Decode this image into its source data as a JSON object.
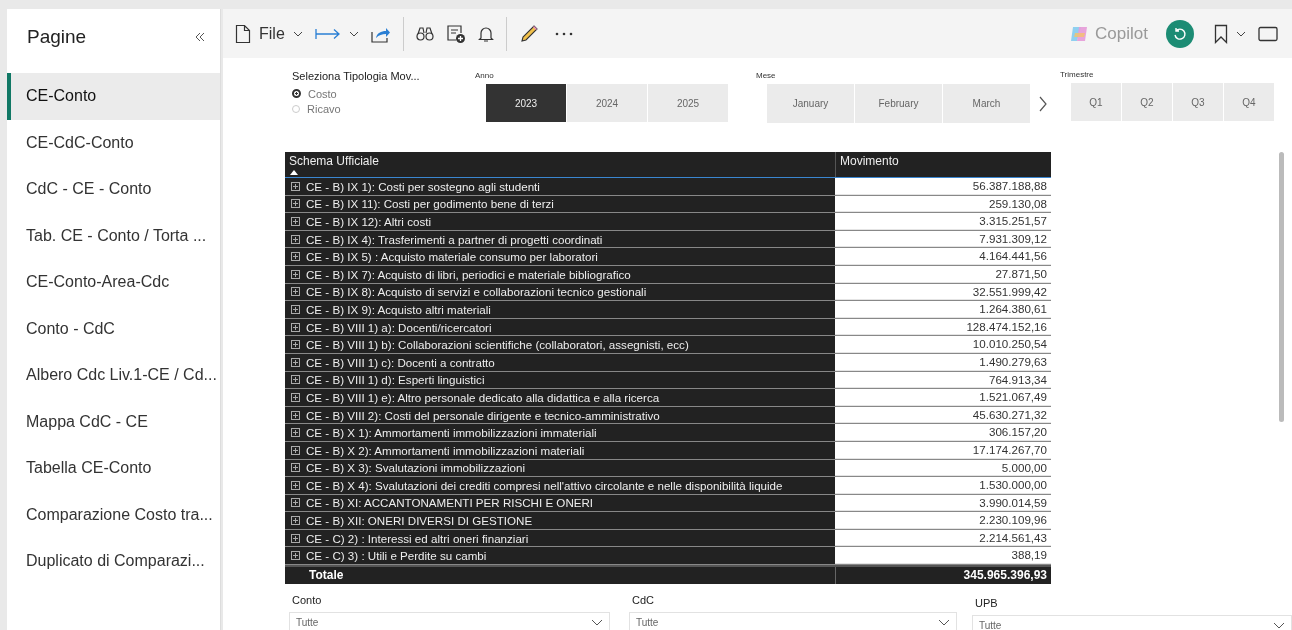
{
  "sidebar": {
    "title": "Pagine",
    "pages": [
      {
        "label": "CE-Conto",
        "selected": true
      },
      {
        "label": "CE-CdC-Conto",
        "selected": false
      },
      {
        "label": "CdC - CE - Conto",
        "selected": false
      },
      {
        "label": "Tab. CE - Conto / Torta ...",
        "selected": false
      },
      {
        "label": "CE-Conto-Area-Cdc",
        "selected": false
      },
      {
        "label": "Conto - CdC",
        "selected": false
      },
      {
        "label": "Albero Cdc Liv.1-CE / Cd...",
        "selected": false
      },
      {
        "label": "Mappa CdC - CE",
        "selected": false
      },
      {
        "label": "Tabella CE-Conto",
        "selected": false
      },
      {
        "label": "Comparazione Costo tra...",
        "selected": false
      },
      {
        "label": "Duplicato di Comparazi...",
        "selected": false
      }
    ]
  },
  "toolbar": {
    "file_label": "File",
    "copilot_label": "Copilot"
  },
  "tipologia": {
    "title": "Seleziona Tipologia Mov...",
    "options": [
      {
        "label": "Costo",
        "selected": true
      },
      {
        "label": "Ricavo",
        "selected": false
      }
    ]
  },
  "anno": {
    "title": "Anno",
    "tiles": [
      {
        "label": "2023",
        "selected": true
      },
      {
        "label": "2024",
        "selected": false
      },
      {
        "label": "2025",
        "selected": false
      }
    ]
  },
  "mese": {
    "title": "Mese",
    "tiles": [
      {
        "label": "January",
        "selected": false
      },
      {
        "label": "February",
        "selected": false
      },
      {
        "label": "March",
        "selected": false
      }
    ]
  },
  "trimestre": {
    "title": "Trimestre",
    "tiles": [
      {
        "label": "Q1",
        "selected": false
      },
      {
        "label": "Q2",
        "selected": false
      },
      {
        "label": "Q3",
        "selected": false
      },
      {
        "label": "Q4",
        "selected": false
      }
    ]
  },
  "table": {
    "columns": [
      "Schema Ufficiale",
      "Movimento"
    ],
    "rows": [
      {
        "label": "CE - B) IX 1): Costi per sostegno agli studenti",
        "value": "56.387.188,88"
      },
      {
        "label": "CE - B) IX 11): Costi per godimento bene di terzi",
        "value": "259.130,08"
      },
      {
        "label": "CE - B) IX 12): Altri costi",
        "value": "3.315.251,57"
      },
      {
        "label": "CE - B) IX 4): Trasferimenti a partner di progetti coordinati",
        "value": "7.931.309,12"
      },
      {
        "label": "CE - B) IX 5) : Acquisto materiale consumo per laboratori",
        "value": "4.164.441,56"
      },
      {
        "label": "CE - B) IX 7): Acquisto di libri, periodici e materiale bibliografico",
        "value": "27.871,50"
      },
      {
        "label": "CE - B) IX 8): Acquisto di servizi e collaborazioni tecnico gestionali",
        "value": "32.551.999,42"
      },
      {
        "label": "CE - B) IX 9): Acquisto altri materiali",
        "value": "1.264.380,61"
      },
      {
        "label": "CE - B) VIII 1) a): Docenti/ricercatori",
        "value": "128.474.152,16"
      },
      {
        "label": "CE - B) VIII 1) b): Collaborazioni scientifiche (collaboratori, assegnisti, ecc)",
        "value": "10.010.250,54"
      },
      {
        "label": "CE - B) VIII 1) c): Docenti a contratto",
        "value": "1.490.279,63"
      },
      {
        "label": "CE - B) VIII 1) d): Esperti linguistici",
        "value": "764.913,34"
      },
      {
        "label": "CE - B) VIII 1) e): Altro personale dedicato alla didattica e alla ricerca",
        "value": "1.521.067,49"
      },
      {
        "label": "CE - B) VIII 2): Costi del personale dirigente e tecnico-amministrativo",
        "value": "45.630.271,32"
      },
      {
        "label": "CE - B) X 1): Ammortamenti immobilizzazioni immateriali",
        "value": "306.157,20"
      },
      {
        "label": "CE - B) X 2): Ammortamenti immobilizzazioni materiali",
        "value": "17.174.267,70"
      },
      {
        "label": "CE - B) X 3): Svalutazioni immobilizzazioni",
        "value": "5.000,00"
      },
      {
        "label": "CE - B) X 4): Svalutazioni dei crediti compresi nell'attivo circolante e nelle disponibilità liquide",
        "value": "1.530.000,00"
      },
      {
        "label": "CE - B) XI: ACCANTONAMENTI PER RISCHI E ONERI",
        "value": "3.990.014,59"
      },
      {
        "label": "CE - B) XII: ONERI DIVERSI DI GESTIONE",
        "value": "2.230.109,96"
      },
      {
        "label": "CE - C) 2) : Interessi ed altri oneri finanziari",
        "value": "2.214.561,43"
      },
      {
        "label": "CE - C) 3) : Utili e Perdite su cambi",
        "value": "388,19"
      }
    ],
    "total": {
      "label": "Totale",
      "value": "345.965.396,93"
    }
  },
  "dropdowns": [
    {
      "title": "Conto",
      "value": "Tutte"
    },
    {
      "title": "CdC",
      "value": "Tutte"
    },
    {
      "title": "UPB",
      "value": "Tutte"
    }
  ]
}
